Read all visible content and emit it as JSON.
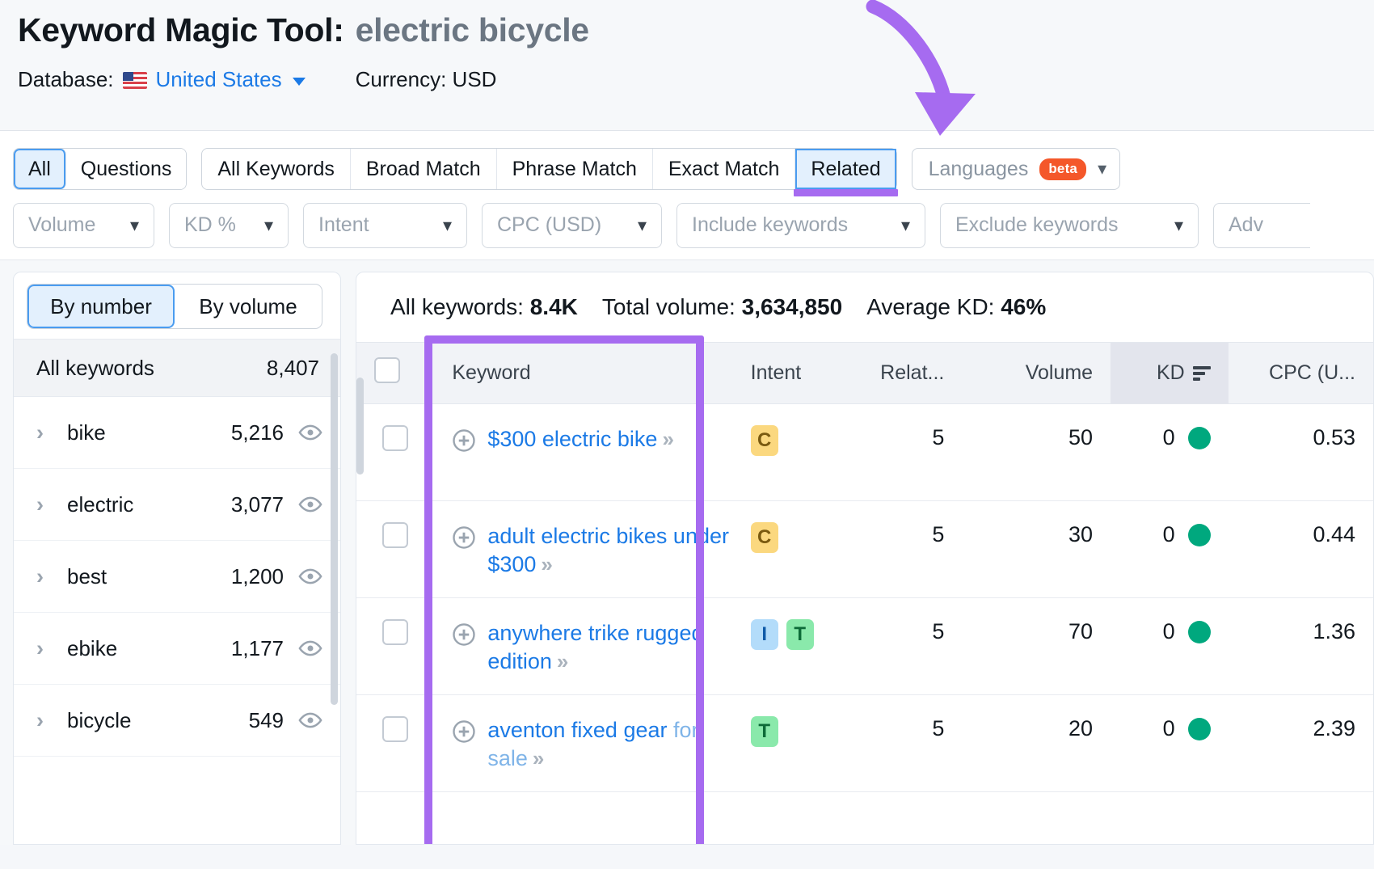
{
  "header": {
    "tool_name": "Keyword Magic Tool:",
    "query": "electric bicycle",
    "database_label": "Database:",
    "database_value": "United States",
    "currency_label": "Currency: USD"
  },
  "tabs": {
    "primary": [
      {
        "label": "All",
        "active": true
      },
      {
        "label": "Questions",
        "active": false
      }
    ],
    "match_types": [
      {
        "label": "All Keywords",
        "active": false
      },
      {
        "label": "Broad Match",
        "active": false
      },
      {
        "label": "Phrase Match",
        "active": false
      },
      {
        "label": "Exact Match",
        "active": false
      },
      {
        "label": "Related",
        "active": true
      }
    ],
    "languages": {
      "label": "Languages",
      "badge": "beta"
    }
  },
  "filters": [
    {
      "label": "Volume"
    },
    {
      "label": "KD %"
    },
    {
      "label": "Intent"
    },
    {
      "label": "CPC (USD)"
    },
    {
      "label": "Include keywords"
    },
    {
      "label": "Exclude keywords"
    },
    {
      "label": "Adv"
    }
  ],
  "sidebar": {
    "toggle": [
      {
        "label": "By number",
        "active": true
      },
      {
        "label": "By volume",
        "active": false
      }
    ],
    "all_keywords_label": "All keywords",
    "all_keywords_count": "8,407",
    "items": [
      {
        "label": "bike",
        "count": "5,216"
      },
      {
        "label": "electric",
        "count": "3,077"
      },
      {
        "label": "best",
        "count": "1,200"
      },
      {
        "label": "ebike",
        "count": "1,177"
      },
      {
        "label": "bicycle",
        "count": "549"
      }
    ]
  },
  "summary": {
    "all_keywords_label": "All keywords:",
    "all_keywords_value": "8.4K",
    "total_volume_label": "Total volume:",
    "total_volume_value": "3,634,850",
    "average_kd_label": "Average KD:",
    "average_kd_value": "46%"
  },
  "table": {
    "columns": [
      {
        "key": "keyword",
        "label": "Keyword"
      },
      {
        "key": "intent",
        "label": "Intent"
      },
      {
        "key": "relat",
        "label": "Relat..."
      },
      {
        "key": "volume",
        "label": "Volume"
      },
      {
        "key": "kd",
        "label": "KD"
      },
      {
        "key": "cpc",
        "label": "CPC (U..."
      }
    ],
    "rows": [
      {
        "keyword": "$300 electric bike",
        "keyword_faded": "",
        "intent": [
          "C"
        ],
        "relat": "5",
        "volume": "50",
        "kd": "0",
        "cpc": "0.53"
      },
      {
        "keyword": "adult electric bikes under $300",
        "keyword_faded": "",
        "intent": [
          "C"
        ],
        "relat": "5",
        "volume": "30",
        "kd": "0",
        "cpc": "0.44"
      },
      {
        "keyword": "anywhere trike rugged edition",
        "keyword_faded": "",
        "intent": [
          "I",
          "T"
        ],
        "relat": "5",
        "volume": "70",
        "kd": "0",
        "cpc": "1.36"
      },
      {
        "keyword": "aventon fixed gear",
        "keyword_faded": "for sale",
        "intent": [
          "T"
        ],
        "relat": "5",
        "volume": "20",
        "kd": "0",
        "cpc": "2.39"
      }
    ]
  },
  "colors": {
    "annotation_purple": "#a66bf0",
    "link_blue": "#1b7ae6",
    "kd_green": "#00a87e",
    "beta_orange": "#f4572a"
  }
}
